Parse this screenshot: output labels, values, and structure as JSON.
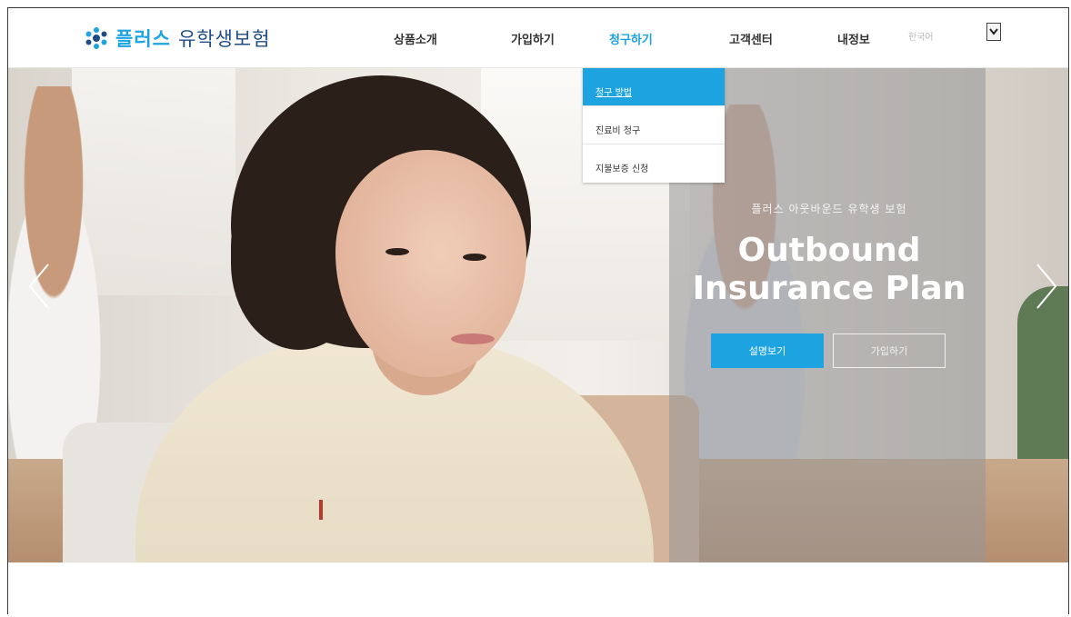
{
  "brand": {
    "name": "플러스",
    "subtitle": "유학생보험",
    "accent_color": "#1ca3e0",
    "subtitle_color": "#1f4c86"
  },
  "nav": {
    "items": [
      {
        "label": "상품소개"
      },
      {
        "label": "가입하기"
      },
      {
        "label": "청구하기"
      },
      {
        "label": "고객센터"
      },
      {
        "label": "내정보"
      }
    ],
    "active_index": 2
  },
  "language": {
    "selected": "한국어"
  },
  "dropdown": {
    "items": [
      {
        "label": "청구 방법"
      },
      {
        "label": "진료비 청구"
      },
      {
        "label": "지불보증 신청"
      }
    ],
    "active_index": 0
  },
  "hero": {
    "subtitle": "플러스 아웃바운드 유학생 보험",
    "title_line1": "Outbound",
    "title_line2": "Insurance Plan",
    "primary_button": "설명보기",
    "secondary_button": "가입하기",
    "icons": [
      "chevron-left-icon",
      "chevron-right-icon"
    ]
  }
}
